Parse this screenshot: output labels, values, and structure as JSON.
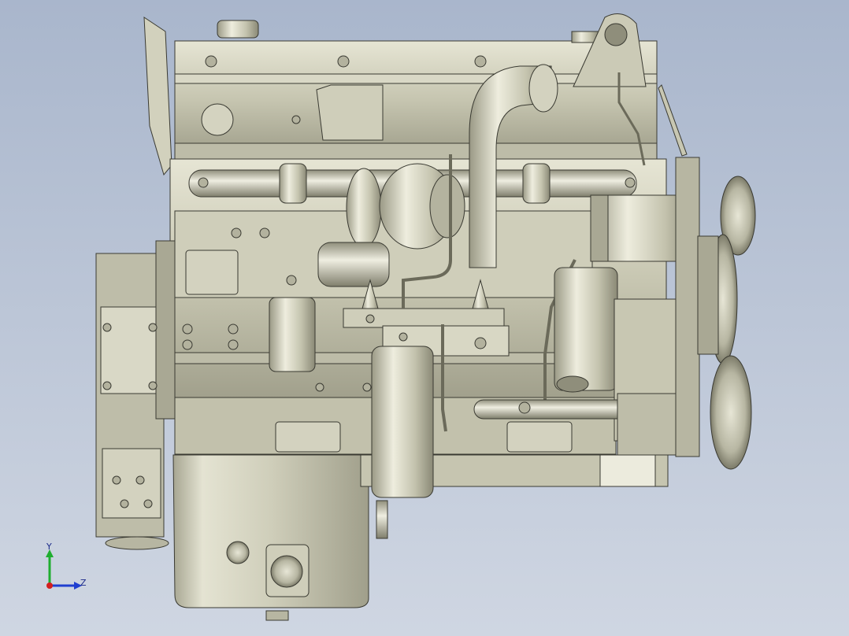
{
  "viewport": {
    "background_top": "#a9b6cc",
    "background_bottom": "#cfd6e2"
  },
  "model": {
    "body_color": "#c8c7b2",
    "shadow_color": "#8e8d7a",
    "highlight_color": "#ecebdd",
    "edge_color": "#3a3a32"
  },
  "triad": {
    "y_label": "Y",
    "z_label": "Z",
    "y_color": "#1fae2f",
    "z_color": "#1f3fd0",
    "x_color": "#d41f1f"
  }
}
